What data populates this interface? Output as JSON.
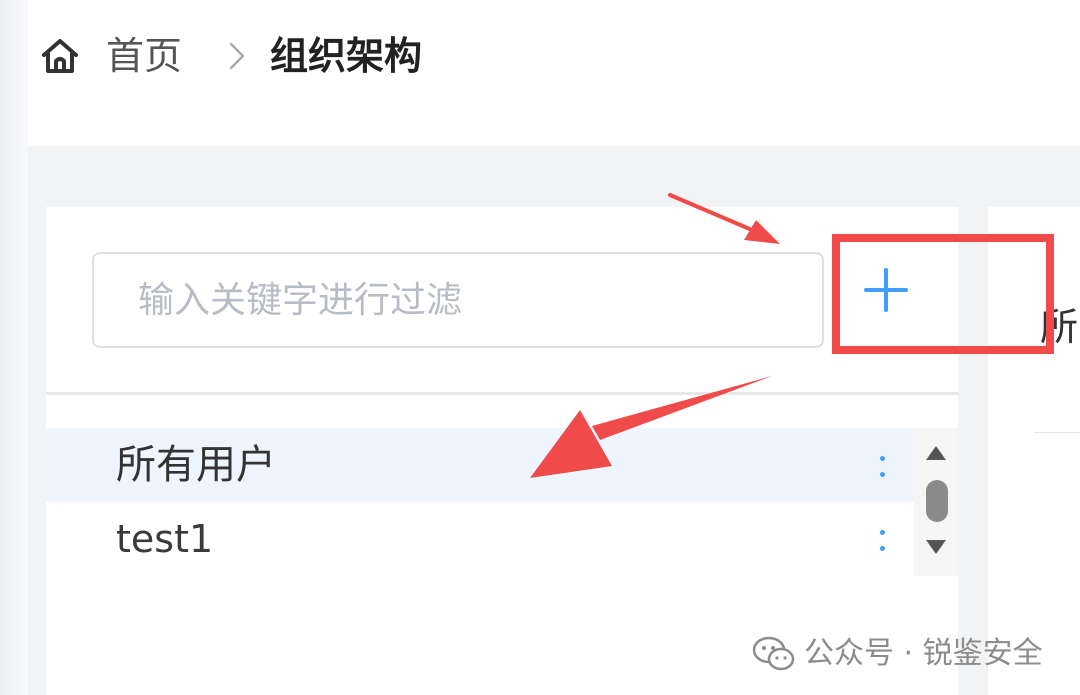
{
  "breadcrumb": {
    "home_icon": "home-icon",
    "home_label": "首页",
    "separator_icon": "chevron-right-icon",
    "current_label": "组织架构"
  },
  "search": {
    "placeholder": "输入关键字进行过滤",
    "value": ""
  },
  "add_button": {
    "icon": "plus-icon",
    "color": "#409eff"
  },
  "tree": {
    "items": [
      {
        "label": "所有用户",
        "selected": true,
        "more_icon": "more-vertical-icon"
      },
      {
        "label": "test1",
        "selected": false,
        "more_icon": "more-vertical-icon"
      }
    ]
  },
  "right_panel": {
    "heading": "所"
  },
  "annotation": {
    "color": "#f04a4a"
  },
  "watermark": {
    "icon": "wechat-icon",
    "text": "公众号 · 锐鉴安全"
  },
  "colors": {
    "accent": "#409eff",
    "selected_row": "#eef5fe",
    "page_bg": "#f2f3f5"
  }
}
